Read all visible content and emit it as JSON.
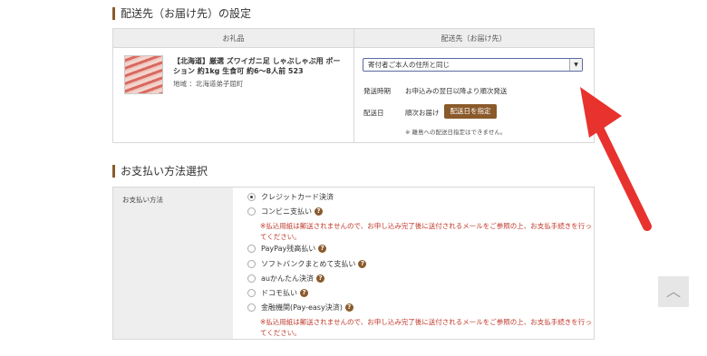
{
  "shipping": {
    "title": "配送先（お届け先）の設定",
    "col_gift": "お礼品",
    "col_dest": "配送先（お届け先）",
    "gift_name": "【北海道】厳選 ズワイガニ足 しゃぶしゃぶ用 ポーション 約1kg 生食可 約6〜8人前 523",
    "gift_area": "地域 ：北海道弟子屈町",
    "address_select": "寄付者ご本人の住所と同じ",
    "time_label": "発送時期",
    "time_value": "お申込みの翌日以降より順次発送",
    "date_label": "配送日",
    "date_value": "順次お届け",
    "date_button": "配送日を指定",
    "island_note": "※ 離島への配送日指定はできません。"
  },
  "payment": {
    "title": "お支払い方法選択",
    "label": "お支払い方法",
    "options": [
      "クレジットカード決済",
      "コンビニ支払い",
      "PayPay残高払い",
      "ソフトバンクまとめて支払い",
      "auかんたん決済",
      "ドコモ払い",
      "金融機関(Pay-easy決済)"
    ],
    "warning": "※払込用紙は郵送されませんので、お申し込み完了後に送付されるメールをご参照の上、お支払手続きを行ってください。"
  },
  "icons": {
    "help": "?",
    "select_arrow": "▼",
    "scroll_top": "︿"
  },
  "colors": {
    "accent": "#8a5a2b",
    "warning": "#c0392b",
    "annotation": "#e8322d"
  }
}
